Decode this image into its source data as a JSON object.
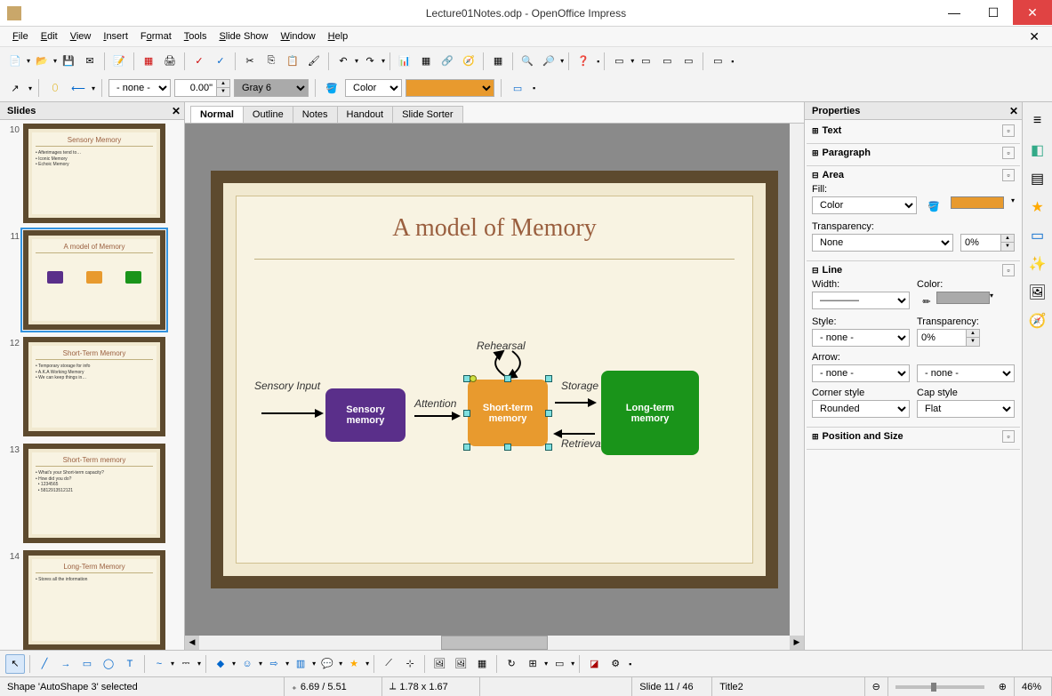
{
  "window": {
    "title": "Lecture01Notes.odp - OpenOffice Impress"
  },
  "menu": {
    "file": "File",
    "edit": "Edit",
    "view": "View",
    "insert": "Insert",
    "format": "Format",
    "tools": "Tools",
    "slideshow": "Slide Show",
    "window": "Window",
    "help": "Help"
  },
  "toolbar2": {
    "linestyle": "- none -",
    "linewidth": "0.00\"",
    "linecolor": "Gray 6",
    "fill_mode": "Color"
  },
  "slidepanel": {
    "title": "Slides"
  },
  "thumbs": [
    {
      "n": "10",
      "title": "Sensory Memory"
    },
    {
      "n": "11",
      "title": "A model of Memory"
    },
    {
      "n": "12",
      "title": "Short-Term Memory"
    },
    {
      "n": "13",
      "title": "Short-Term memory"
    },
    {
      "n": "14",
      "title": "Long-Term Memory"
    }
  ],
  "viewtabs": {
    "normal": "Normal",
    "outline": "Outline",
    "notes": "Notes",
    "handout": "Handout",
    "sorter": "Slide Sorter"
  },
  "slide": {
    "title": "A model of Memory",
    "box1": "Sensory\nmemory",
    "box2": "Short-term\nmemory",
    "box3": "Long-term\nmemory",
    "lab1": "Sensory Input",
    "lab2": "Attention",
    "lab3": "Rehearsal",
    "lab4": "Storage",
    "lab5": "Retrieval"
  },
  "props": {
    "header": "Properties",
    "text": "Text",
    "paragraph": "Paragraph",
    "area": "Area",
    "fill": "Fill:",
    "fill_mode": "Color",
    "transparency": "Transparency:",
    "trans_mode": "None",
    "trans_val": "0%",
    "line": "Line",
    "width": "Width:",
    "color": "Color:",
    "style": "Style:",
    "style_val": "- none -",
    "transparency2": "Transparency:",
    "trans2_val": "0%",
    "arrow": "Arrow:",
    "arrow1": "- none -",
    "arrow2": "- none -",
    "corner": "Corner style",
    "corner_val": "Rounded",
    "cap": "Cap style",
    "cap_val": "Flat",
    "possize": "Position and Size"
  },
  "status": {
    "sel": "Shape 'AutoShape 3' selected",
    "pos": "6.69 / 5.51",
    "size": "1.78 x 1.67",
    "slide": "Slide 11 / 46",
    "master": "Title2",
    "zoom": "46%"
  }
}
